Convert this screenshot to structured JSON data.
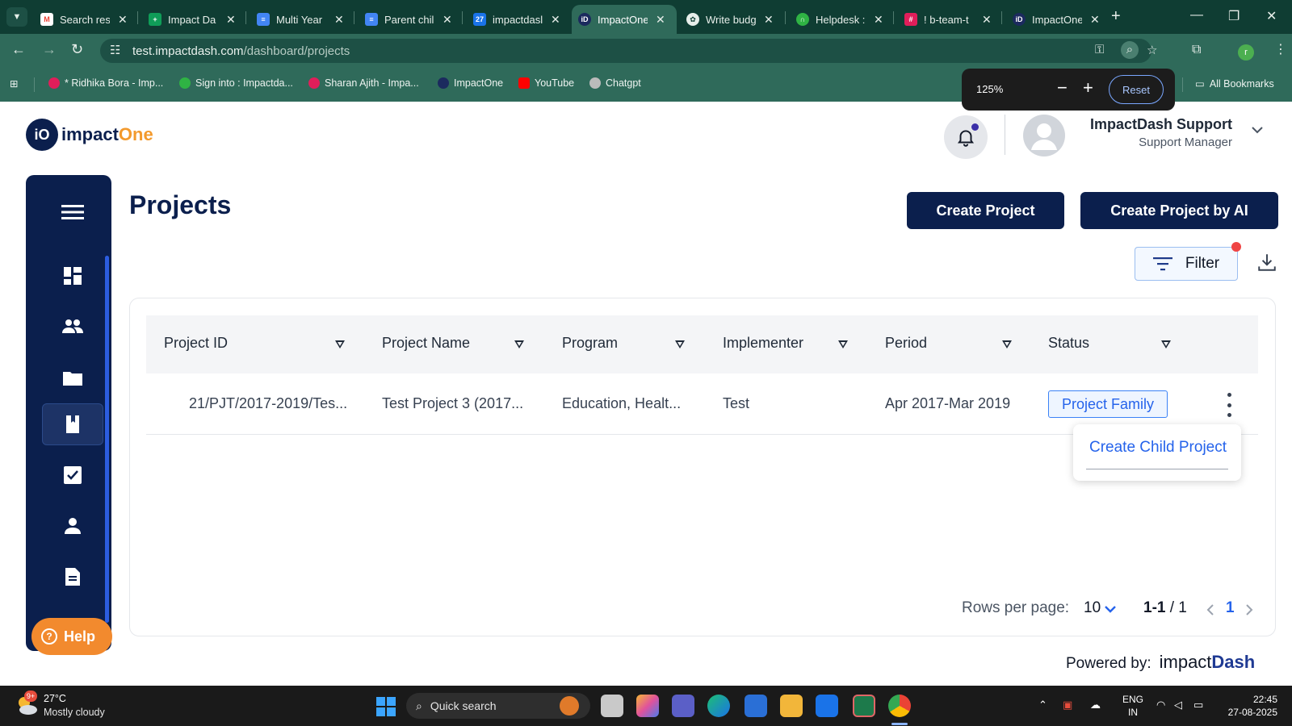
{
  "browser": {
    "tabs": [
      {
        "label": "Search res",
        "favicon": "gmail-icon",
        "color": "#ea4335"
      },
      {
        "label": "Impact Da",
        "favicon": "sheets-icon",
        "color": "#0f9d58"
      },
      {
        "label": "Multi Year",
        "favicon": "docs-icon",
        "color": "#4285f4"
      },
      {
        "label": "Parent chil",
        "favicon": "docs-icon",
        "color": "#4285f4"
      },
      {
        "label": "impactdasl",
        "favicon": "calendar-icon",
        "color": "#1a73e8"
      },
      {
        "label": "ImpactOne",
        "favicon": "impactone-icon",
        "color": "#1b2a5e",
        "active": true
      },
      {
        "label": "Write budg",
        "favicon": "chatgpt-icon",
        "color": "#666666"
      },
      {
        "label": "Helpdesk :",
        "favicon": "helpdesk-icon",
        "color": "#2fb344"
      },
      {
        "label": "! b-team-t",
        "favicon": "slack-icon",
        "color": "#e01e5a"
      },
      {
        "label": "ImpactOne",
        "favicon": "impactone-icon",
        "color": "#1b2a5e"
      }
    ],
    "url_host": "test.impactdash.com",
    "url_path": "/dashboard/projects",
    "bookmarks": [
      {
        "label": "* Ridhika Bora - Imp...",
        "color": "#e01e5a"
      },
      {
        "label": "Sign into : Impactda...",
        "color": "#2fb344"
      },
      {
        "label": "Sharan Ajith - Impa...",
        "color": "#e01e5a"
      },
      {
        "label": "ImpactOne",
        "color": "#1b2a5e"
      },
      {
        "label": "YouTube",
        "color": "#ff0000"
      },
      {
        "label": "Chatgpt",
        "color": "#999999"
      }
    ],
    "all_bookmarks": "All Bookmarks",
    "zoom": {
      "level": "125%",
      "minus": "−",
      "plus": "+",
      "reset": "Reset"
    },
    "profile_initial": "r"
  },
  "header": {
    "logo_prefix": "impact",
    "logo_accent": "One",
    "logo_badge": "iO",
    "user_name": "ImpactDash Support",
    "user_role": "Support Manager"
  },
  "page": {
    "title": "Projects",
    "create_project": "Create Project",
    "create_project_ai": "Create Project by AI",
    "filter": "Filter"
  },
  "table": {
    "columns": [
      "Project ID",
      "Project Name",
      "Program",
      "Implementer",
      "Period",
      "Status"
    ],
    "rows": [
      {
        "project_id": "21/PJT/2017-2019/Tes...",
        "project_name": "Test Project 3 (2017...",
        "program": "Education, Healt...",
        "implementer": "Test",
        "period": "Apr 2017-Mar 2019",
        "status": "Project Family"
      }
    ]
  },
  "context_menu": {
    "item": "Create Child Project"
  },
  "pagination": {
    "rows_label": "Rows per page:",
    "rows_value": "10",
    "range": "1-1",
    "total": "/ 1",
    "current_page": "1"
  },
  "footer": {
    "powered_label": "Powered by:",
    "brand_prefix": "impact",
    "brand_accent": "Dash"
  },
  "help": {
    "label": "Help"
  },
  "taskbar": {
    "temp": "27°C",
    "weather": "Mostly cloudy",
    "weather_badge": "9+",
    "search_placeholder": "Quick search",
    "lang_1": "ENG",
    "lang_2": "IN",
    "time": "22:45",
    "date": "27-08-2025"
  },
  "colors": {
    "navy": "#0b1f4d",
    "accent_orange": "#f28a2e",
    "link_blue": "#2563eb",
    "chrome_green": "#2f6a5a"
  }
}
